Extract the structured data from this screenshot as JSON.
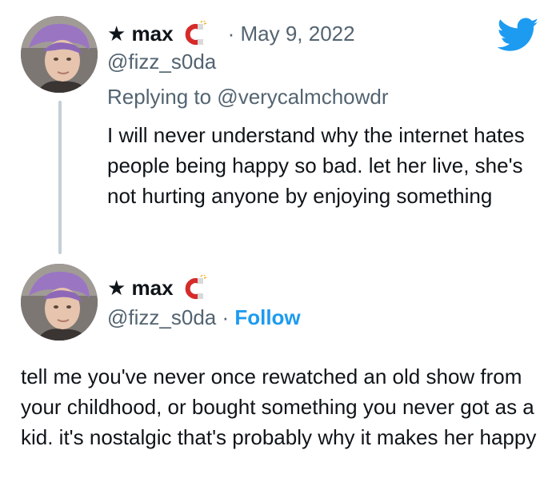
{
  "tweet1": {
    "display_name": "★ max",
    "date_sep": "·",
    "date": "May 9, 2022",
    "handle": "@fizz_s0da",
    "replying_to": "Replying to @verycalmchowdr",
    "text": "I will never understand why the internet hates people being happy so bad. let her live, she's not hurting anyone by enjoying something"
  },
  "tweet2": {
    "display_name": "★ max",
    "handle": "@fizz_s0da",
    "sep": " · ",
    "follow_label": "Follow",
    "text": "tell me you've never once rewatched an old show from your childhood, or bought something you never got as a kid. it's nostalgic that's probably why it makes her happy"
  },
  "icons": {
    "brand": "twitter-bird-icon",
    "emoji": "magnet-icon",
    "brand_color": "#1d9bf0",
    "link_color": "#1d9bf0",
    "muted_color": "#536471"
  }
}
